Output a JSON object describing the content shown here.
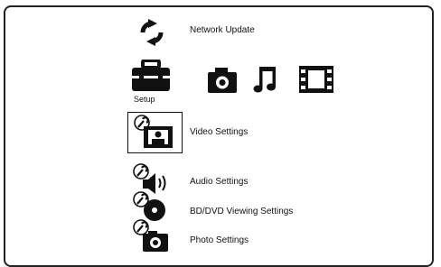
{
  "menu": {
    "network_update": "Network Update",
    "setup_label": "Setup",
    "settings": [
      {
        "label": "Video Settings"
      },
      {
        "label": "Audio Settings"
      },
      {
        "label": "BD/DVD Viewing Settings"
      },
      {
        "label": "Photo Settings"
      }
    ]
  },
  "icons": {
    "network_update": "refresh-icon",
    "setup": "toolbox-icon",
    "photo": "camera-icon",
    "music": "music-note-icon",
    "video": "film-strip-icon"
  },
  "colors": {
    "foreground": "#111111",
    "background": "#ffffff"
  }
}
